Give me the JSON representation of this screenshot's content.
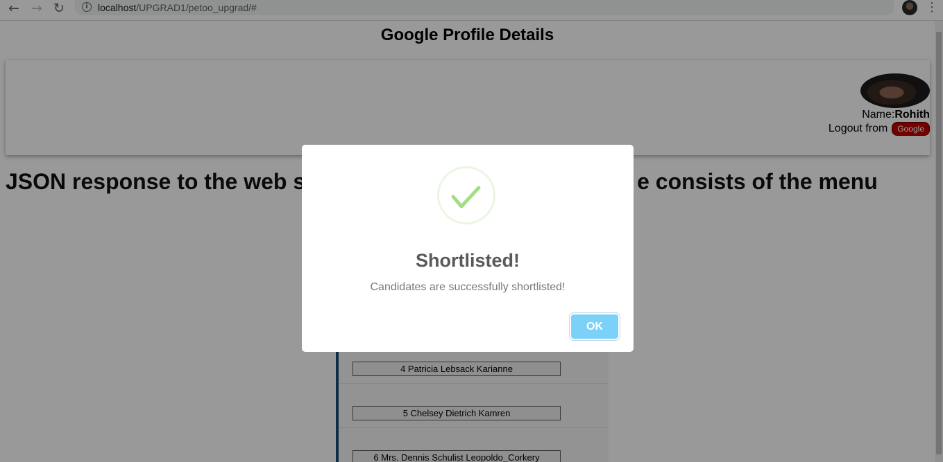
{
  "browser": {
    "back_glyph": "←",
    "forward_glyph": "→",
    "reload_glyph": "↻",
    "info_glyph": "i",
    "url_host": "localhost",
    "url_path": "/UPGRAD1/petoo_upgrad/#",
    "star_glyph": "☆",
    "menu_glyph": "⋮"
  },
  "page": {
    "title": "Google Profile Details",
    "profile": {
      "name_label": "Name:",
      "name_value": "Rohith",
      "logout_label": "Logout from",
      "logout_button": "Google"
    },
    "heading_left": "JSON response to the web s",
    "heading_right": "e consists of the menu",
    "candidates": [
      "4 Patricia Lebsack Karianne",
      "5 Chelsey Dietrich Kamren",
      "6 Mrs. Dennis Schulist Leopoldo_Corkery"
    ]
  },
  "modal": {
    "title": "Shortlisted!",
    "text": "Candidates are successfully shortlisted!",
    "ok_label": "OK",
    "icon": "success-check-icon",
    "accent_color": "#a5dc86",
    "button_color": "#7cd1f9"
  }
}
